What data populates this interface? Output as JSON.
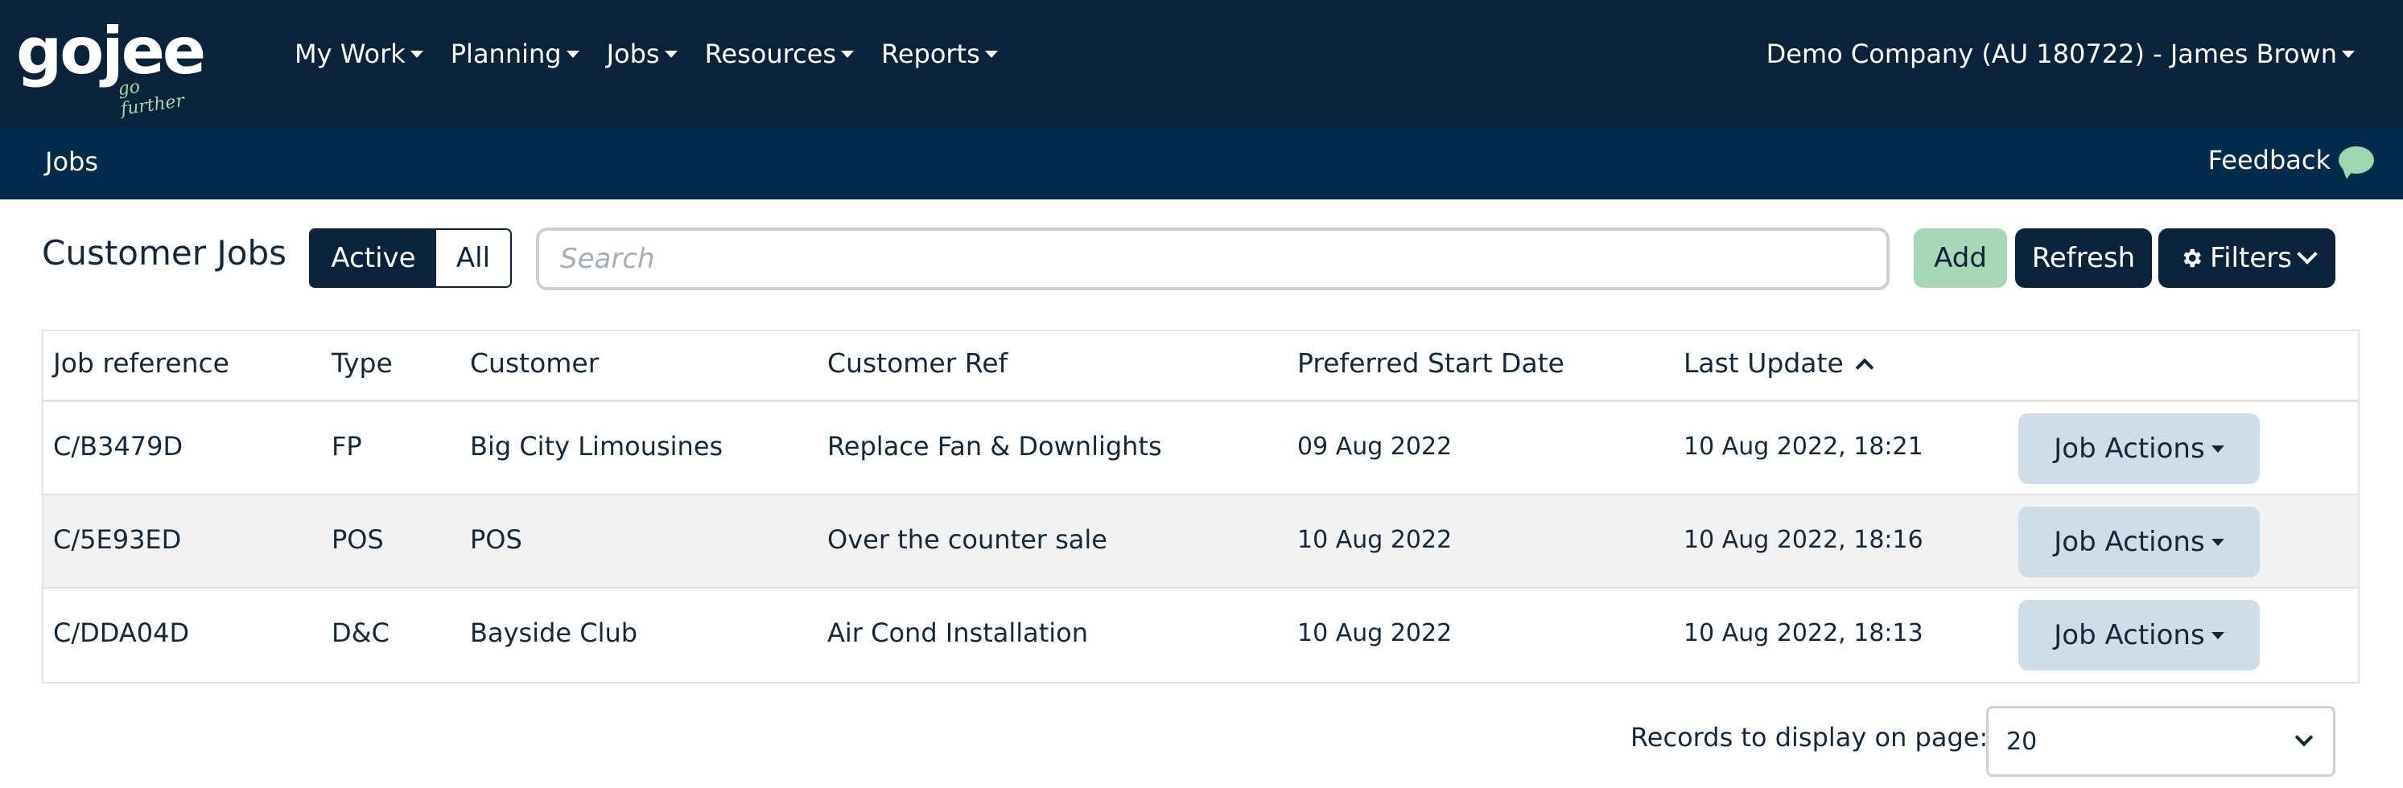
{
  "brand": {
    "logo_word": "gojee",
    "logo_tagline": "go further"
  },
  "nav": {
    "items": [
      {
        "label": "My Work"
      },
      {
        "label": "Planning"
      },
      {
        "label": "Jobs"
      },
      {
        "label": "Resources"
      },
      {
        "label": "Reports"
      }
    ],
    "account": "Demo Company (AU 180722) - James Brown"
  },
  "subbar": {
    "breadcrumb": "Jobs",
    "feedback": "Feedback"
  },
  "toolbar": {
    "title": "Customer Jobs",
    "toggle_active": "Active",
    "toggle_all": "All",
    "search_placeholder": "Search",
    "add": "Add",
    "refresh": "Refresh",
    "filters": "Filters"
  },
  "table": {
    "columns": [
      "Job reference",
      "Type",
      "Customer",
      "Customer Ref",
      "Preferred Start Date",
      "Last Update"
    ],
    "sorted_column": "Last Update",
    "sort_direction": "ascending",
    "action_label": "Job Actions",
    "rows": [
      {
        "ref": "C/B3479D",
        "type": "FP",
        "customer": "Big City Limousines",
        "customer_ref": "Replace Fan & Downlights",
        "start": "09 Aug 2022",
        "updated": "10 Aug 2022, 18:21"
      },
      {
        "ref": "C/5E93ED",
        "type": "POS",
        "customer": "POS",
        "customer_ref": "Over the counter sale",
        "start": "10 Aug 2022",
        "updated": "10 Aug 2022, 18:16"
      },
      {
        "ref": "C/DDA04D",
        "type": "D&C",
        "customer": "Bayside Club",
        "customer_ref": "Air Cond Installation",
        "start": "10 Aug 2022",
        "updated": "10 Aug 2022, 18:13"
      }
    ]
  },
  "pager": {
    "label": "Records to display on page:",
    "value": "20"
  },
  "colors": {
    "navy": "#0b2338",
    "subbar": "#002b4a",
    "accent_green": "#a7d7b8",
    "action_bg": "#d1dde6"
  }
}
